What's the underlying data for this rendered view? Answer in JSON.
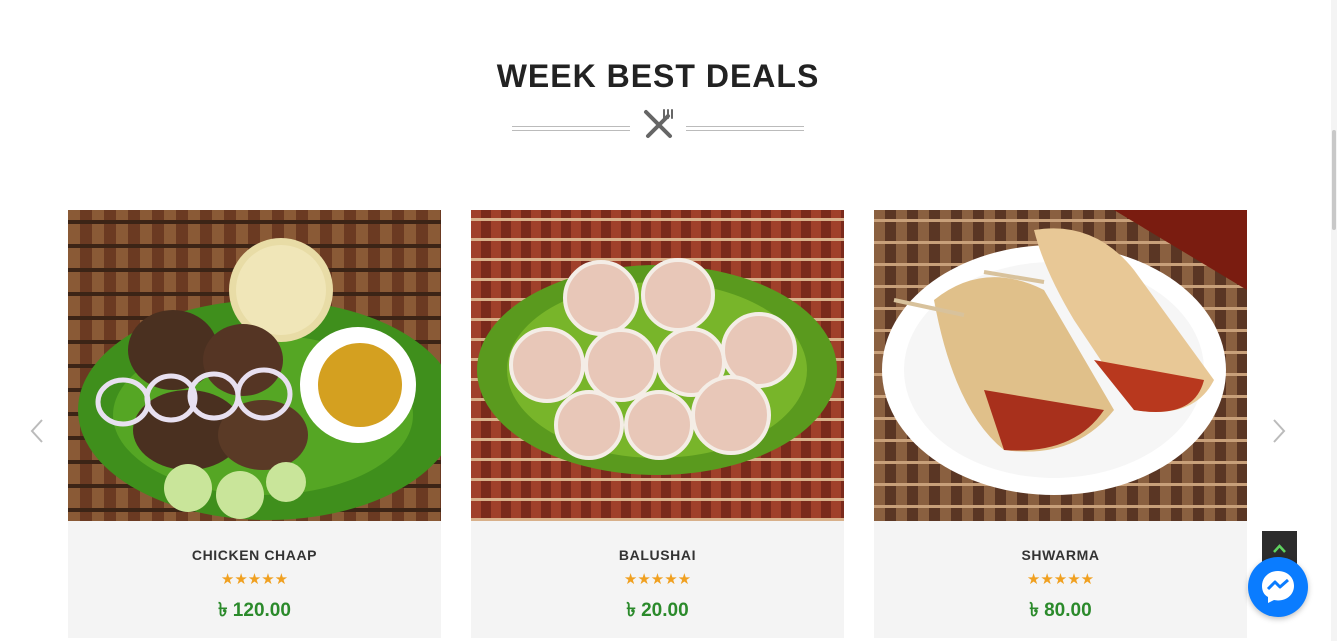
{
  "section": {
    "title": "WEEK BEST DEALS",
    "divider_icon": "fork-knife-icon"
  },
  "products": [
    {
      "name": "CHICKEN CHAAP",
      "rating": 5,
      "stars": "★★★★★",
      "price": "৳ 120.00"
    },
    {
      "name": "BALUSHAI",
      "rating": 5,
      "stars": "★★★★★",
      "price": "৳ 20.00"
    },
    {
      "name": "SHWARMA",
      "rating": 5,
      "stars": "★★★★★",
      "price": "৳ 80.00"
    }
  ],
  "carousel": {
    "prev_icon": "chevron-left-icon",
    "next_icon": "chevron-right-icon"
  },
  "widgets": {
    "back_to_top_icon": "chevron-up-icon",
    "chat_icon": "messenger-icon"
  },
  "colors": {
    "price": "#2b8a2b",
    "stars": "#f0a020",
    "card_bg": "#f4f4f4",
    "title": "#222222",
    "messenger": "#0a7cff"
  }
}
